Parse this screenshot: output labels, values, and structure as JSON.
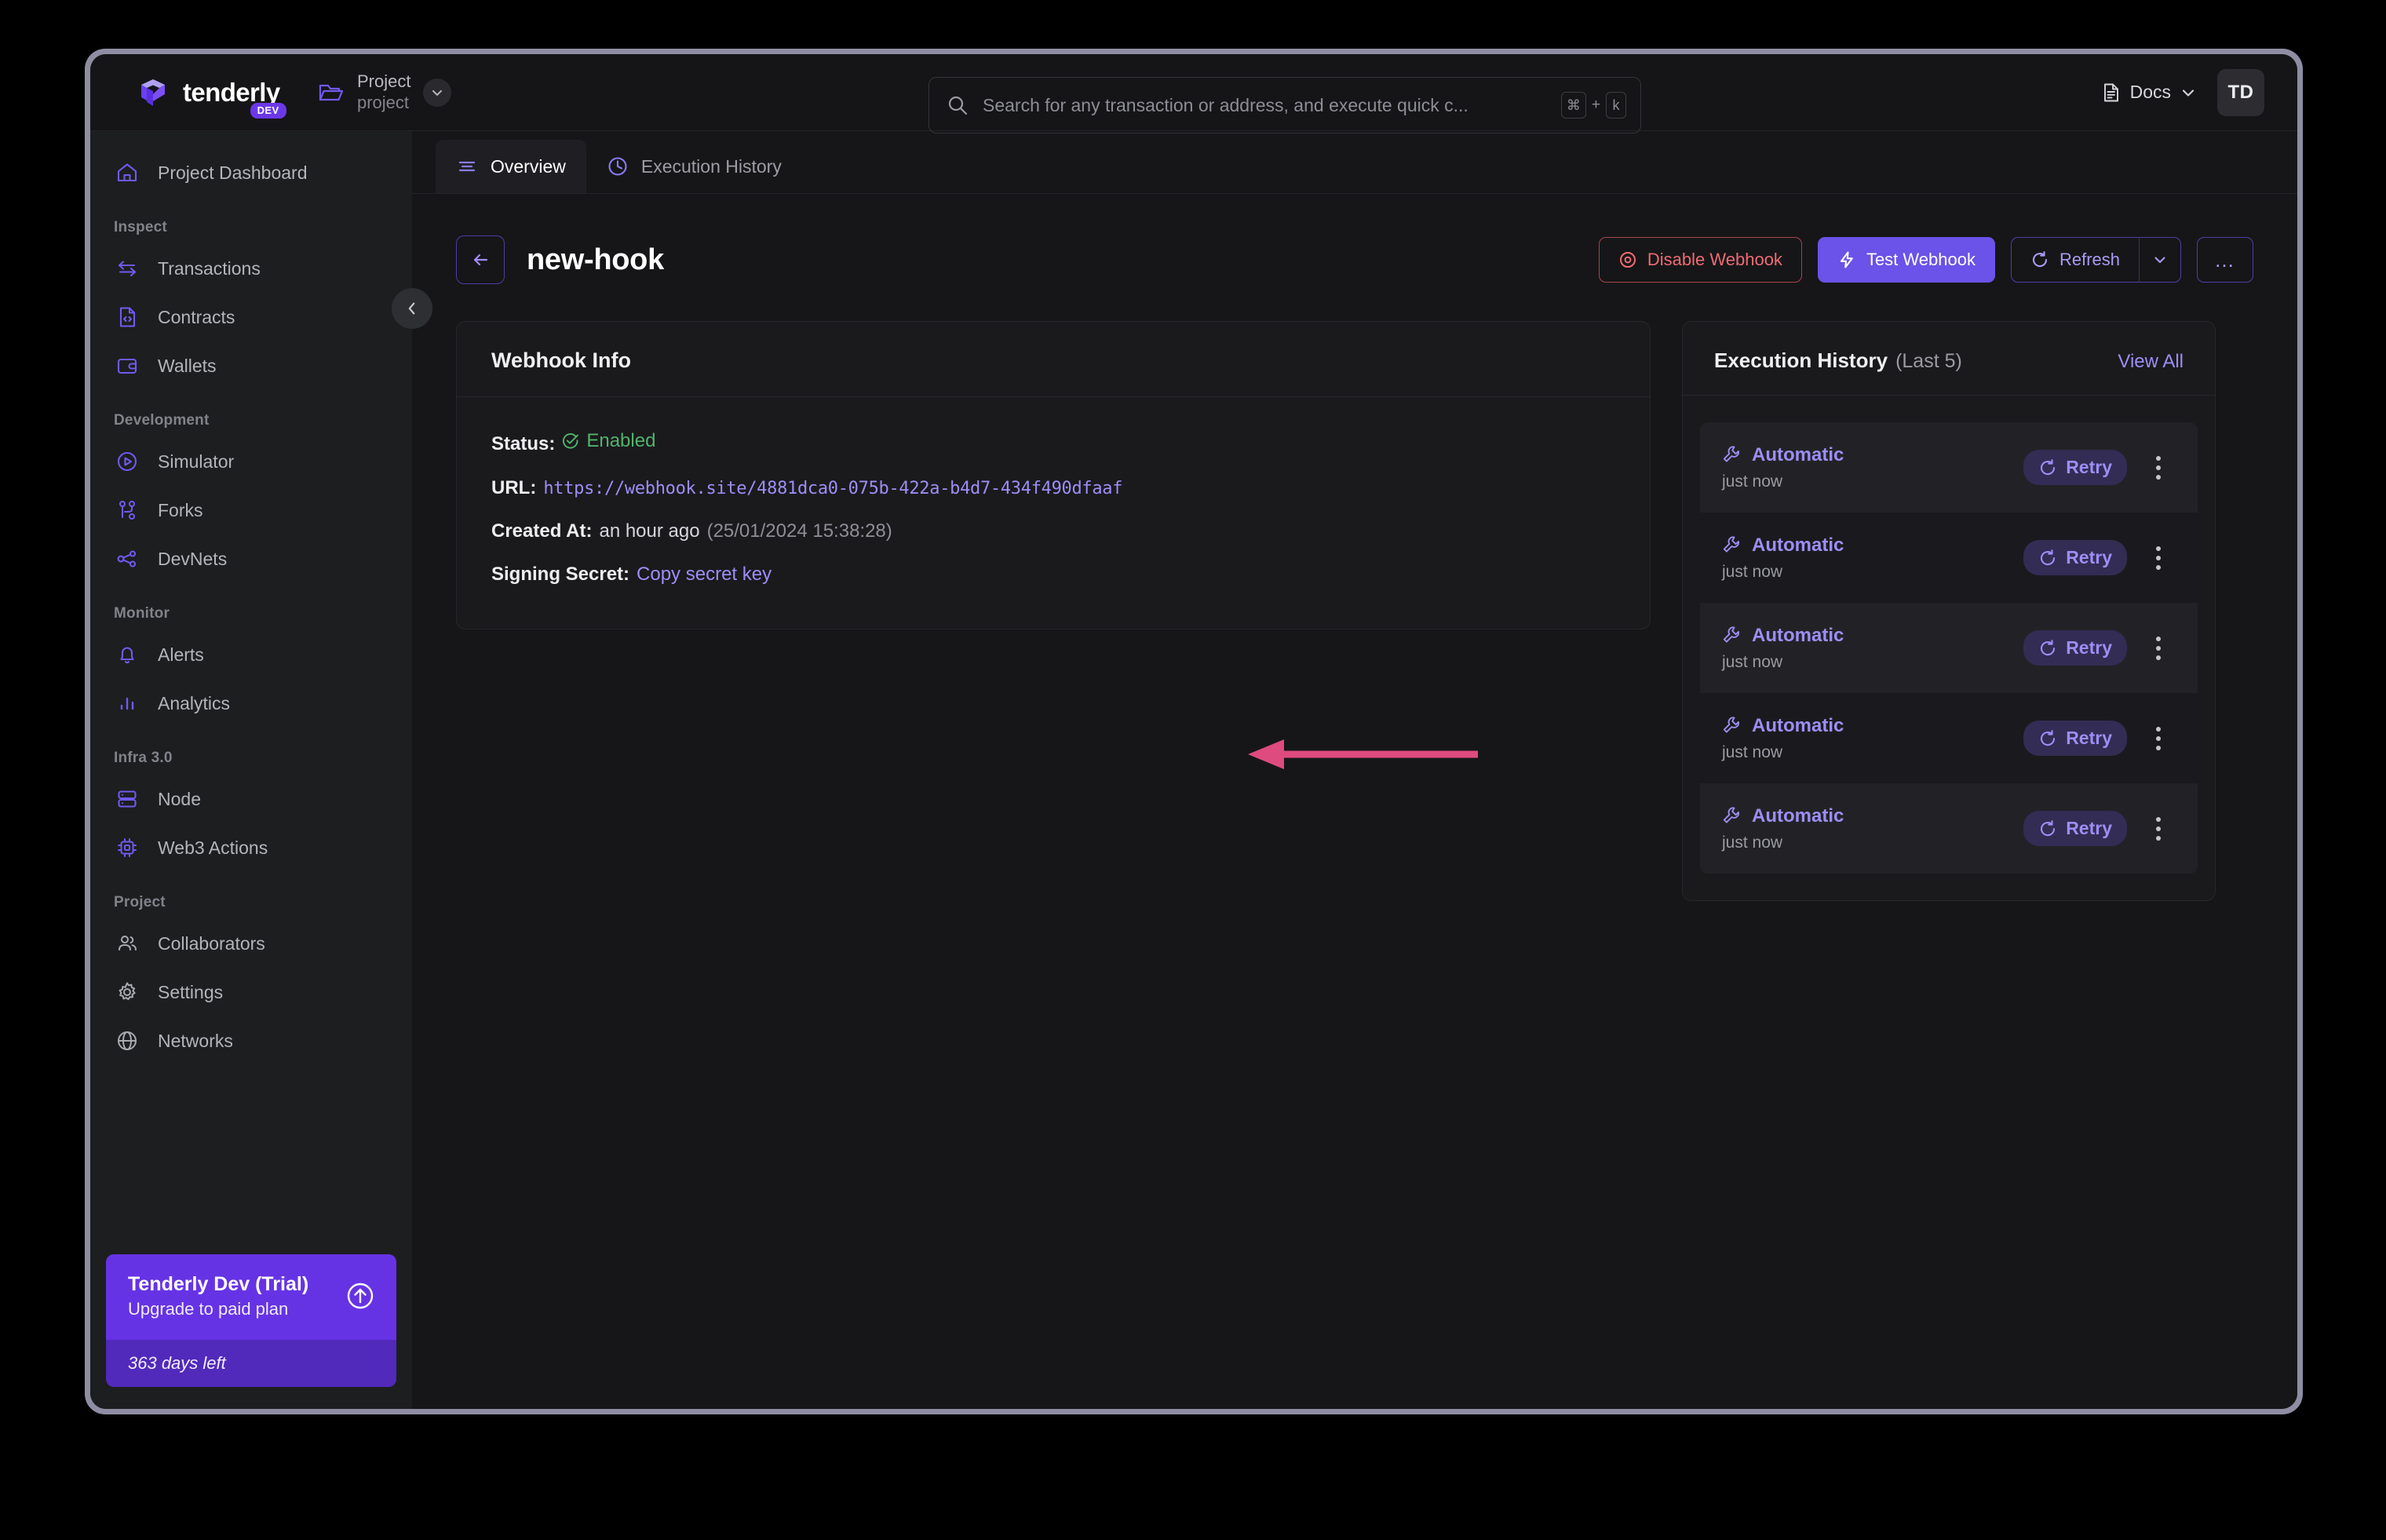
{
  "topbar": {
    "brand_name": "tenderly",
    "brand_badge": "DEV",
    "project": {
      "title": "Project",
      "subtitle": "project"
    },
    "search": {
      "value": "",
      "placeholder": "Search for any transaction or address, and execute quick c...",
      "shortcut_key": "⌘",
      "shortcut_plus": "+",
      "shortcut_letter": "k"
    },
    "docs_label": "Docs",
    "avatar_initials": "TD"
  },
  "sidebar": {
    "dashboard": {
      "label": "Project Dashboard",
      "icon": "home-icon"
    },
    "groups": [
      {
        "label": "Inspect",
        "items": [
          {
            "label": "Transactions",
            "icon": "transactions-icon"
          },
          {
            "label": "Contracts",
            "icon": "contract-file-icon"
          },
          {
            "label": "Wallets",
            "icon": "wallet-icon"
          }
        ]
      },
      {
        "label": "Development",
        "items": [
          {
            "label": "Simulator",
            "icon": "play-circle-icon"
          },
          {
            "label": "Forks",
            "icon": "fork-icon"
          },
          {
            "label": "DevNets",
            "icon": "devnets-icon"
          }
        ]
      },
      {
        "label": "Monitor",
        "items": [
          {
            "label": "Alerts",
            "icon": "bell-icon"
          },
          {
            "label": "Analytics",
            "icon": "bar-chart-icon"
          }
        ]
      },
      {
        "label": "Infra 3.0",
        "items": [
          {
            "label": "Node",
            "icon": "server-icon"
          },
          {
            "label": "Web3 Actions",
            "icon": "chip-icon"
          }
        ]
      },
      {
        "label": "Project",
        "items": [
          {
            "label": "Collaborators",
            "icon": "users-icon"
          },
          {
            "label": "Settings",
            "icon": "gear-icon"
          },
          {
            "label": "Networks",
            "icon": "globe-icon"
          }
        ]
      }
    ],
    "trial": {
      "title": "Tenderly Dev (Trial)",
      "subtitle": "Upgrade to paid plan",
      "days_left": "363 days left"
    }
  },
  "tabs": [
    {
      "label": "Overview",
      "icon": "list-icon",
      "active": true
    },
    {
      "label": "Execution History",
      "icon": "clock-icon",
      "active": false
    }
  ],
  "page": {
    "title": "new-hook",
    "actions": {
      "disable": "Disable Webhook",
      "test": "Test Webhook",
      "refresh": "Refresh",
      "more": "…"
    }
  },
  "webhook_info": {
    "card_title": "Webhook Info",
    "status_key": "Status:",
    "status_value": "Enabled",
    "url_key": "URL:",
    "url_value": "https://webhook.site/4881dca0-075b-422a-b4d7-434f490dfaaf",
    "created_key": "Created At:",
    "created_value": "an hour ago",
    "created_exact": "(25/01/2024 15:38:28)",
    "secret_key": "Signing Secret:",
    "secret_action": "Copy secret key"
  },
  "execution_history": {
    "title": "Execution History",
    "count_label": "(Last 5)",
    "view_all": "View All",
    "rows": [
      {
        "type": "Automatic",
        "when": "just now",
        "retry": "Retry"
      },
      {
        "type": "Automatic",
        "when": "just now",
        "retry": "Retry"
      },
      {
        "type": "Automatic",
        "when": "just now",
        "retry": "Retry"
      },
      {
        "type": "Automatic",
        "when": "just now",
        "retry": "Retry"
      },
      {
        "type": "Automatic",
        "when": "just now",
        "retry": "Retry"
      }
    ]
  },
  "colors": {
    "accent_purple": "#6b52e8",
    "link_purple": "#9d8ef5",
    "danger_red": "#ef6b73",
    "success_green": "#53b36a",
    "annotation_pink": "#de4b7e",
    "window_border": "#8e8da3",
    "sidebar_bg": "#1d1e20",
    "content_bg": "#161618"
  }
}
